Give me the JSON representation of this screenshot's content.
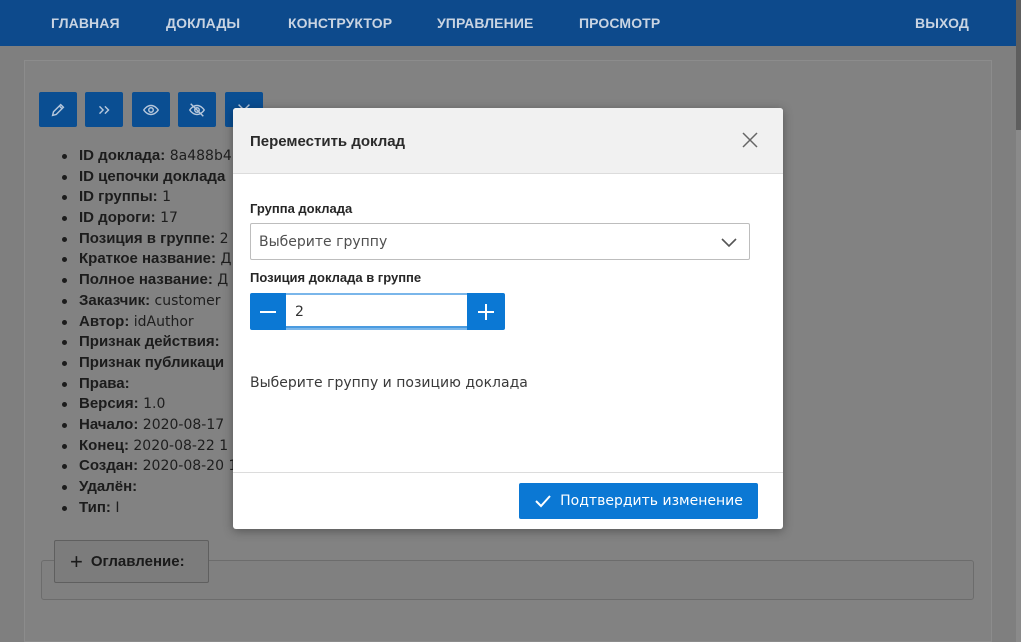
{
  "nav": {
    "items": [
      "ГЛАВНАЯ",
      "ДОКЛАДЫ",
      "КОНСТРУКТОР",
      "УПРАВЛЕНИЕ",
      "ПРОСМОТР"
    ],
    "logout": "ВЫХОД"
  },
  "toolbar": {
    "icons": [
      "edit-icon",
      "forward-icon",
      "eye-icon",
      "eye-off-icon",
      "close-icon"
    ]
  },
  "props": [
    {
      "label": "ID доклада:",
      "value": " 8a488b4"
    },
    {
      "label": "ID цепочки доклада",
      "value": ""
    },
    {
      "label": "ID группы:",
      "value": " 1"
    },
    {
      "label": "ID дороги:",
      "value": " 17"
    },
    {
      "label": "Позиция в группе:",
      "value": " 2"
    },
    {
      "label": "Краткое название:",
      "value": " Д"
    },
    {
      "label": "Полное название:",
      "value": " Д"
    },
    {
      "label": "Заказчик:",
      "value": " customer"
    },
    {
      "label": "Автор:",
      "value": " idAuthor"
    },
    {
      "label": "Признак действия:",
      "value": ""
    },
    {
      "label": "Признак публикаци",
      "value": ""
    },
    {
      "label": "Права:",
      "value": ""
    },
    {
      "label": "Версия:",
      "value": " 1.0"
    },
    {
      "label": "Начало:",
      "value": " 2020-08-17"
    },
    {
      "label": "Конец:",
      "value": " 2020-08-22 1"
    },
    {
      "label": "Создан:",
      "value": " 2020-08-20 1"
    },
    {
      "label": "Удалён:",
      "value": ""
    },
    {
      "label": "Тип:",
      "value": " I"
    }
  ],
  "toc": {
    "label": "Оглавление:"
  },
  "modal": {
    "title": "Переместить доклад",
    "group_label": "Группа доклада",
    "group_placeholder": "Выберите группу",
    "position_label": "Позиция доклада в группе",
    "position_value": "2",
    "hint": "Выберите группу и позицию доклада",
    "confirm": "Подтвердить изменение"
  },
  "colors": {
    "nav_bg": "#0d4a8c",
    "primary": "#0b78d4"
  }
}
